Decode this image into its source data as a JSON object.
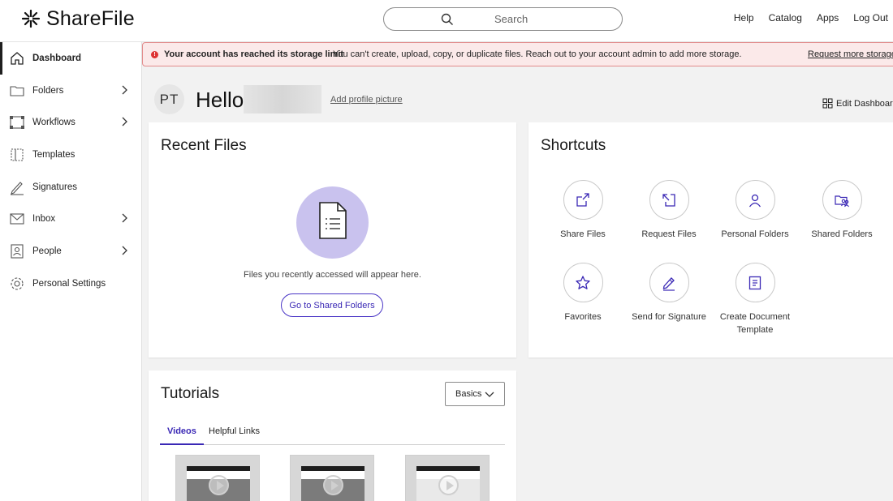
{
  "app": {
    "brand": "ShareFile"
  },
  "search": {
    "placeholder": "Search"
  },
  "topnav": {
    "help": "Help",
    "catalog": "Catalog",
    "apps": "Apps",
    "logout": "Log Out"
  },
  "sidebar": {
    "items": [
      {
        "label": "Dashboard",
        "icon": "home-icon",
        "active": true,
        "expandable": false
      },
      {
        "label": "Folders",
        "icon": "folder-icon",
        "expandable": true
      },
      {
        "label": "Workflows",
        "icon": "workflow-icon",
        "expandable": true
      },
      {
        "label": "Templates",
        "icon": "template-icon",
        "expandable": false
      },
      {
        "label": "Signatures",
        "icon": "signature-icon",
        "expandable": false
      },
      {
        "label": "Inbox",
        "icon": "inbox-icon",
        "expandable": true
      },
      {
        "label": "People",
        "icon": "people-icon",
        "expandable": true
      },
      {
        "label": "Personal Settings",
        "icon": "settings-gear-icon",
        "expandable": false
      }
    ]
  },
  "banner": {
    "title": "Your account has reached its storage limit",
    "message": "You can't create, upload, copy, or duplicate files. Reach out to your account admin to add more storage.",
    "link": "Request more storage",
    "color": "#fbe9e9"
  },
  "greeting": {
    "initials": "PT",
    "hello": "Hello",
    "add_picture": "Add profile picture",
    "edit_dashboard": "Edit Dashboard"
  },
  "recent": {
    "title": "Recent Files",
    "empty_text": "Files you recently accessed will appear here.",
    "button": "Go to Shared Folders"
  },
  "shortcuts": {
    "title": "Shortcuts",
    "items": [
      {
        "label": "Share Files",
        "icon": "share-icon"
      },
      {
        "label": "Request Files",
        "icon": "request-icon"
      },
      {
        "label": "Personal Folders",
        "icon": "person-icon"
      },
      {
        "label": "Shared Folders",
        "icon": "shared-folder-icon"
      },
      {
        "label": "Favorites",
        "icon": "star-icon"
      },
      {
        "label": "Send for Signature",
        "icon": "pen-icon"
      },
      {
        "label": "Create Document Template",
        "icon": "document-icon"
      }
    ]
  },
  "tutorials": {
    "title": "Tutorials",
    "select": "Basics",
    "tabs": [
      "Videos",
      "Helpful Links"
    ],
    "active_tab": "Videos"
  },
  "accent": "#3a28b5"
}
